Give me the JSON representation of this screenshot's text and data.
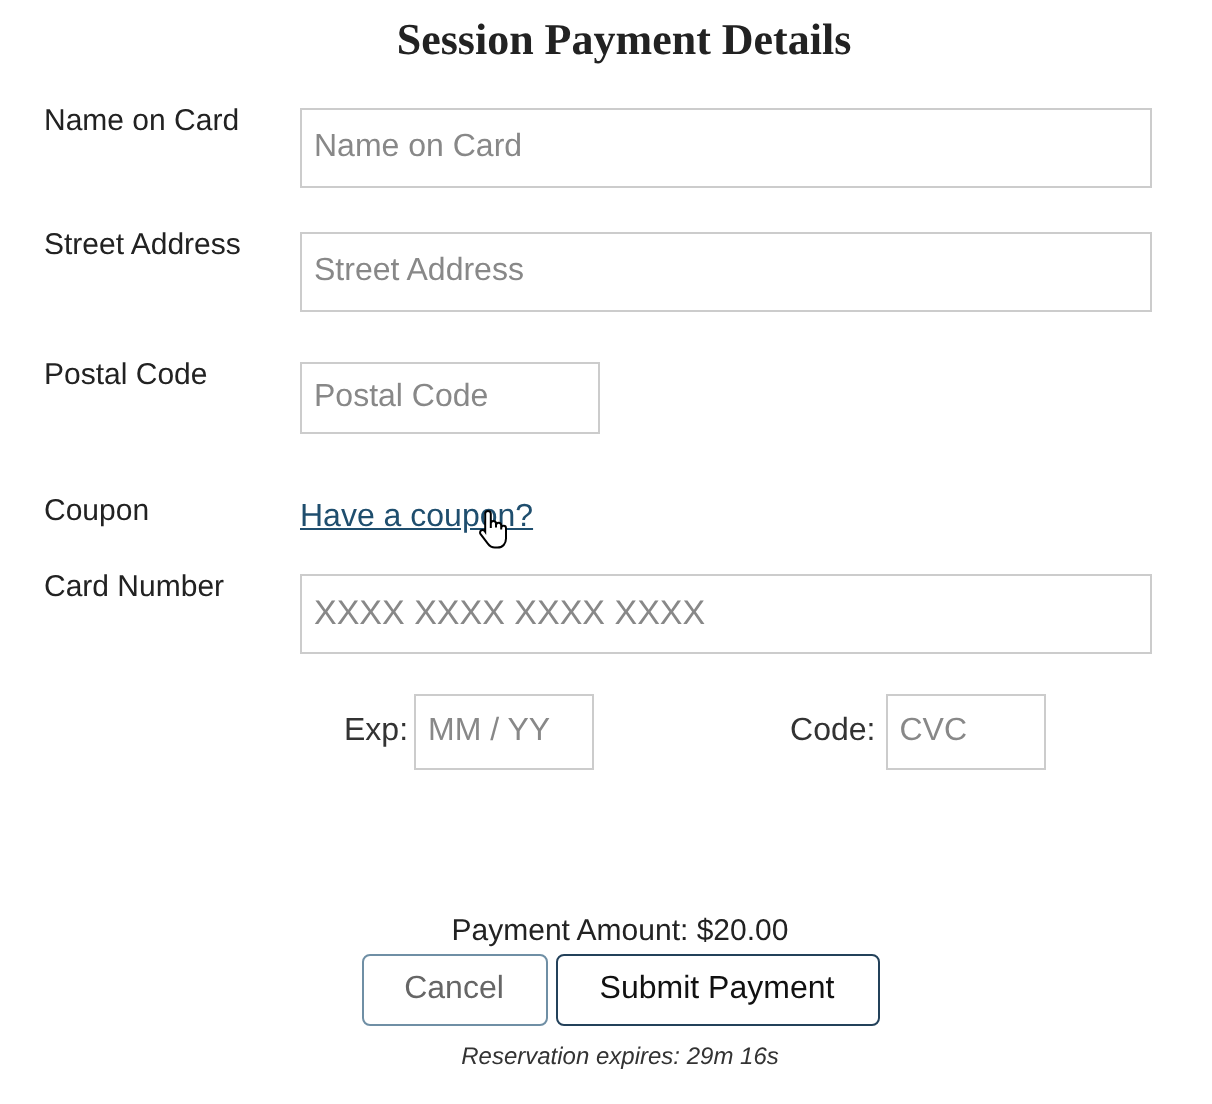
{
  "title": "Session Payment Details",
  "fields": [
    {
      "label": "Name on Card",
      "kind": "wide-input",
      "placeholder": "Name on Card"
    },
    {
      "label": "Street Address",
      "kind": "wide-input",
      "placeholder": "Street Address"
    },
    {
      "label": "Postal Code",
      "kind": "short-input",
      "placeholder": "Postal Code"
    },
    {
      "label": "Coupon",
      "kind": "link",
      "link": "Have a coupon?"
    },
    {
      "label": "Card Number",
      "kind": "card-input",
      "placeholder": "XXXX XXXX XXXX XXXX"
    }
  ],
  "expiry": {
    "label": "Exp:",
    "placeholder": "MM / YY"
  },
  "code": {
    "label": "Code:",
    "placeholder": "CVC"
  },
  "payment_amount": "Payment Amount: $20.00",
  "buttons": [
    {
      "label": "Cancel",
      "kind": "secondary"
    },
    {
      "label": "Submit Payment",
      "kind": "primary"
    }
  ],
  "reservation_note": "Reservation expires: 29m 16s"
}
